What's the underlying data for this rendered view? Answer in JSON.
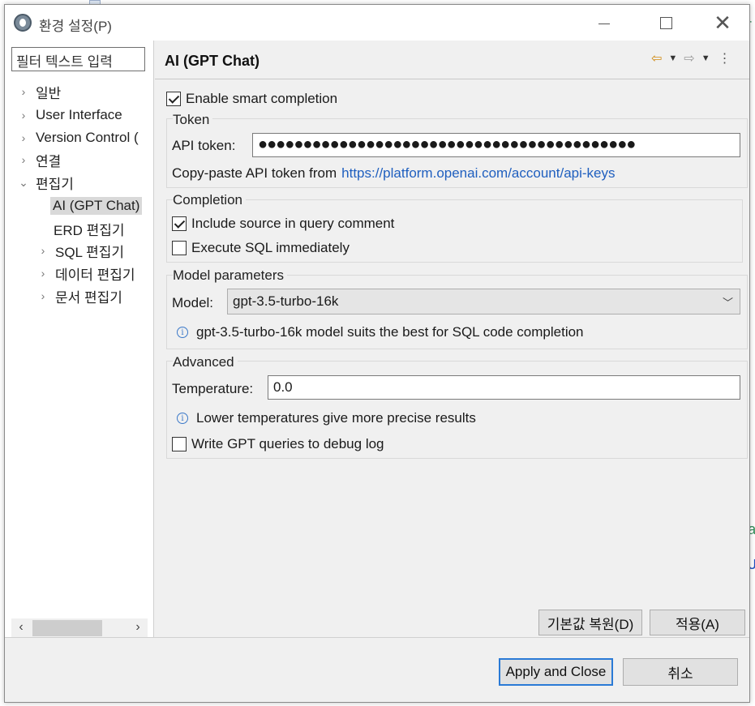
{
  "window": {
    "title": "환경 설정(P)"
  },
  "nav": {
    "filter_placeholder": "필터 텍스트 입력",
    "items": [
      {
        "label": "일반",
        "chevron": "›"
      },
      {
        "label": "User Interface",
        "chevron": "›"
      },
      {
        "label": "Version Control (",
        "chevron": "›"
      },
      {
        "label": "연결",
        "chevron": "›"
      },
      {
        "label": "편집기",
        "chevron": "⌄"
      },
      {
        "label": "AI (GPT Chat)",
        "chevron": ""
      },
      {
        "label": "ERD 편집기",
        "chevron": ""
      },
      {
        "label": "SQL 편집기",
        "chevron": "›"
      },
      {
        "label": "데이터 편집기",
        "chevron": "›"
      },
      {
        "label": "문서 편집기",
        "chevron": "›"
      }
    ]
  },
  "page": {
    "title": "AI (GPT Chat)",
    "enable_smart_completion": {
      "label": "Enable smart completion",
      "checked": true
    },
    "token": {
      "group_title": "Token",
      "api_label": "API token:",
      "api_value": "●●●●●●●●●●●●●●●●●●●●●●●●●●●●●●●●●●●●●●●●●●",
      "copy_text": "Copy-paste API token from",
      "link": "https://platform.openai.com/account/api-keys"
    },
    "completion": {
      "group_title": "Completion",
      "include_source": {
        "label": "Include source in query comment",
        "checked": true
      },
      "execute_sql": {
        "label": "Execute SQL immediately",
        "checked": false
      }
    },
    "model_params": {
      "group_title": "Model parameters",
      "model_label": "Model:",
      "model_value": "gpt-3.5-turbo-16k",
      "info": "gpt-3.5-turbo-16k model suits the best for SQL code completion"
    },
    "advanced": {
      "group_title": "Advanced",
      "temperature_label": "Temperature:",
      "temperature_value": "0.0",
      "info": "Lower temperatures give more precise results",
      "debug_log": {
        "label": "Write GPT queries to debug log",
        "checked": false
      }
    },
    "restore_defaults": "기본값 복원(D)",
    "apply": "적용(A)"
  },
  "footer": {
    "apply_close": "Apply and Close",
    "cancel": "취소"
  },
  "colors": {
    "link": "#1f5fbf",
    "primary_border": "#2a7ad6",
    "dialog_bg": "#f0f0f0"
  }
}
